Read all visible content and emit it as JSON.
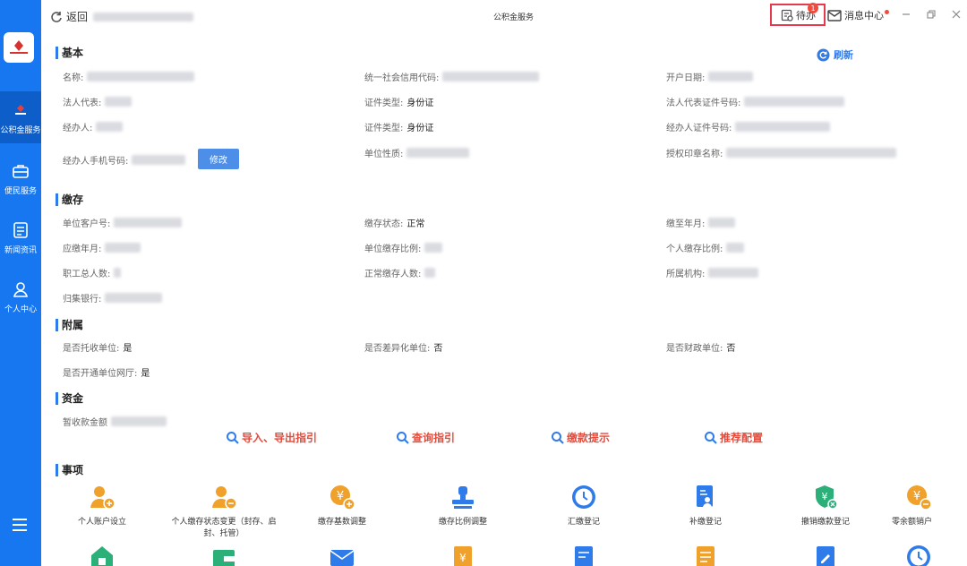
{
  "sidebar": {
    "items": [
      {
        "label": "公积金服务"
      },
      {
        "label": "便民服务"
      },
      {
        "label": "新闻资讯"
      },
      {
        "label": "个人中心"
      }
    ]
  },
  "topbar": {
    "back_label": "返回",
    "title": "公积金服务",
    "todo_label": "待办",
    "todo_count": "1",
    "message_label": "消息中心"
  },
  "basic": {
    "section_title": "基本",
    "refresh_label": "刷新",
    "name_label": "名称:",
    "credit_code_label": "统一社会信用代码:",
    "open_date_label": "开户日期:",
    "legal_rep_label": "法人代表:",
    "cert_type_label_1": "证件类型:",
    "cert_type_value_1": "身份证",
    "legal_cert_no_label": "法人代表证件号码:",
    "agent_label": "经办人:",
    "cert_type_label_2": "证件类型:",
    "cert_type_value_2": "身份证",
    "agent_cert_no_label": "经办人证件号码:",
    "agent_phone_label": "经办人手机号码:",
    "edit_label": "修改",
    "unit_nature_label": "单位性质:",
    "seal_name_label": "授权印章名称:"
  },
  "deposit": {
    "section_title": "缴存",
    "client_no_label": "单位客户号:",
    "status_label": "缴存状态:",
    "status_value": "正常",
    "paid_until_label": "缴至年月:",
    "due_month_label": "应缴年月:",
    "unit_ratio_label": "单位缴存比例:",
    "personal_ratio_label": "个人缴存比例:",
    "total_staff_label": "职工总人数:",
    "normal_count_label": "正常缴存人数:",
    "org_label": "所属机构:",
    "bank_label": "归集银行:"
  },
  "attached": {
    "section_title": "附属",
    "entrusted_label": "是否托收单位:",
    "entrusted_value": "是",
    "diff_label": "是否差异化单位:",
    "diff_value": "否",
    "finance_label": "是否财政单位:",
    "finance_value": "否",
    "hall_label": "是否开通单位网厅:",
    "hall_value": "是"
  },
  "funds": {
    "section_title": "资金",
    "temp_label": "暂收款金额"
  },
  "guides": [
    {
      "label": "导入、导出指引"
    },
    {
      "label": "查询指引"
    },
    {
      "label": "缴款提示"
    },
    {
      "label": "推荐配置"
    }
  ],
  "tasks": {
    "section_title": "事项",
    "row1": [
      {
        "label": "个人账户设立",
        "icon": "person-add-icon"
      },
      {
        "label": "个人缴存状态变更（封存、启封、托管）",
        "icon": "person-status-icon"
      },
      {
        "label": "缴存基数调整",
        "icon": "base-adjust-icon"
      },
      {
        "label": "缴存比例调整",
        "icon": "ratio-stamp-icon"
      },
      {
        "label": "汇缴登记",
        "icon": "clock-icon"
      },
      {
        "label": "补缴登记",
        "icon": "supplement-doc-icon"
      },
      {
        "label": "撤销缴款登记",
        "icon": "revoke-shield-icon"
      },
      {
        "label": "零余额销户",
        "icon": "zero-balance-icon"
      }
    ]
  },
  "colors": {
    "sidebar": "#1677f0",
    "accent": "#2f7bea",
    "guide": "#e64a3b",
    "task_orange": "#f0a12b",
    "task_blue": "#2f7bea",
    "task_green": "#2bb07a"
  }
}
